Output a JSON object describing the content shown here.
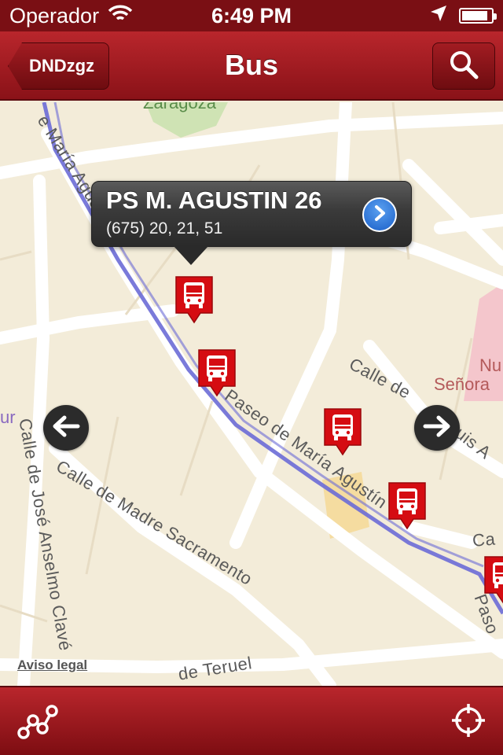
{
  "status_bar": {
    "carrier": "Operador",
    "time": "6:49 PM",
    "battery_level": 0.9
  },
  "nav": {
    "back_label": "DNDzgz",
    "title": "Bus"
  },
  "map": {
    "park_label": "Zaragoza",
    "streets": [
      "e María Agustín",
      "Calle de",
      "Luis A",
      "Paseo de María Agustín",
      "Calle de Madre Sacramento",
      "Calle de José Anselmo Clavé",
      "de Teruel",
      "Paso",
      "Ca"
    ],
    "poi": [
      "Nu",
      "Señora"
    ],
    "poi_left": "ur"
  },
  "callout": {
    "title": "PS M. AGUSTIN 26",
    "subtitle": "(675) 20, 21, 51"
  },
  "legal_link": "Aviso legal",
  "colors": {
    "brand": "#a0161c",
    "pin": "#d50c12",
    "route": "#6b6bd6"
  },
  "icons": {
    "route": "route-icon",
    "locate": "locate-icon"
  }
}
